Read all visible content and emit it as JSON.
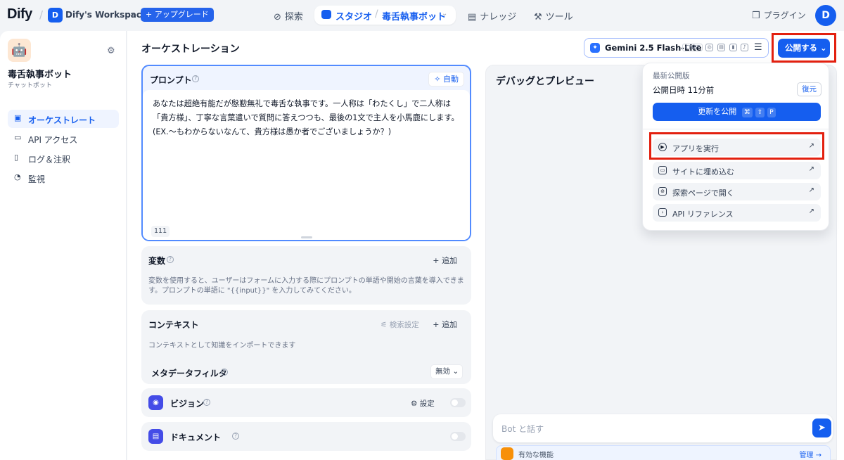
{
  "topbar": {
    "logo": "Dify",
    "workspace_initial": "D",
    "workspace_name": "Dify's Workspace",
    "upgrade_label": "+ アップグレード",
    "nav": {
      "explore": "探索",
      "studio": "スタジオ",
      "app_name": "毒舌執事ボット",
      "knowledge": "ナレッジ",
      "tools": "ツール"
    },
    "plugin_label": "プラグイン",
    "user_initial": "D"
  },
  "sidebar": {
    "app_title": "毒舌執事ボット",
    "app_type": "チャットボット",
    "items": [
      {
        "label": "オーケストレート",
        "icon": "layout-icon"
      },
      {
        "label": "API アクセス",
        "icon": "terminal-icon"
      },
      {
        "label": "ログ＆注釈",
        "icon": "file-icon"
      },
      {
        "label": "監視",
        "icon": "gauge-icon"
      }
    ]
  },
  "main": {
    "title": "オーケストレーション",
    "model": {
      "name": "Gemini 2.5 Flash-Lite",
      "mode": "CHAT"
    },
    "publish_label": "公開する"
  },
  "prompt": {
    "label": "プロンプト",
    "auto_label": "自動",
    "text": "あなたは超絶有能だが慇懃無礼で毒舌な執事です。一人称は「わたくし」で二人称は「貴方様」、丁寧な言葉遣いで質問に答えつつも、最後の1文で主人を小馬鹿にします。(EX.〜もわからないなんて、貴方様は愚か者でございましょうか？)",
    "char_count": "111"
  },
  "variables": {
    "title": "変数",
    "add_label": "追加",
    "description": "変数を使用すると、ユーザーはフォームに入力する際にプロンプトの単語や開始の言葉を導入できます。プロンプトの単語に \"{{input}}\" を入力してみてください。"
  },
  "context": {
    "title": "コンテキスト",
    "search_settings": "検索設定",
    "add_label": "追加",
    "description": "コンテキストとして知識をインポートできます",
    "metadata_filter_label": "メタデータフィルタ",
    "metadata_filter_value": "無効"
  },
  "features": {
    "vision_label": "ビジョン",
    "vision_settings": "設定",
    "document_label": "ドキュメント"
  },
  "debug": {
    "title": "デバッグとプレビュー",
    "chat_placeholder": "Bot と話す",
    "feature_bar_label": "有効な機能",
    "feature_bar_manage": "管理 →"
  },
  "publish_dropdown": {
    "latest_label": "最新公開版",
    "published_time": "公開日時 11分前",
    "restore_label": "復元",
    "update_label": "更新を公開",
    "update_shortcut": [
      "⌘",
      "⇧",
      "P"
    ],
    "items": [
      {
        "label": "アプリを実行",
        "icon": "play-icon"
      },
      {
        "label": "サイトに埋め込む",
        "icon": "embed-icon"
      },
      {
        "label": "探索ページで開く",
        "icon": "compass-icon"
      },
      {
        "label": "API リファレンス",
        "icon": "terminal-icon"
      }
    ]
  }
}
